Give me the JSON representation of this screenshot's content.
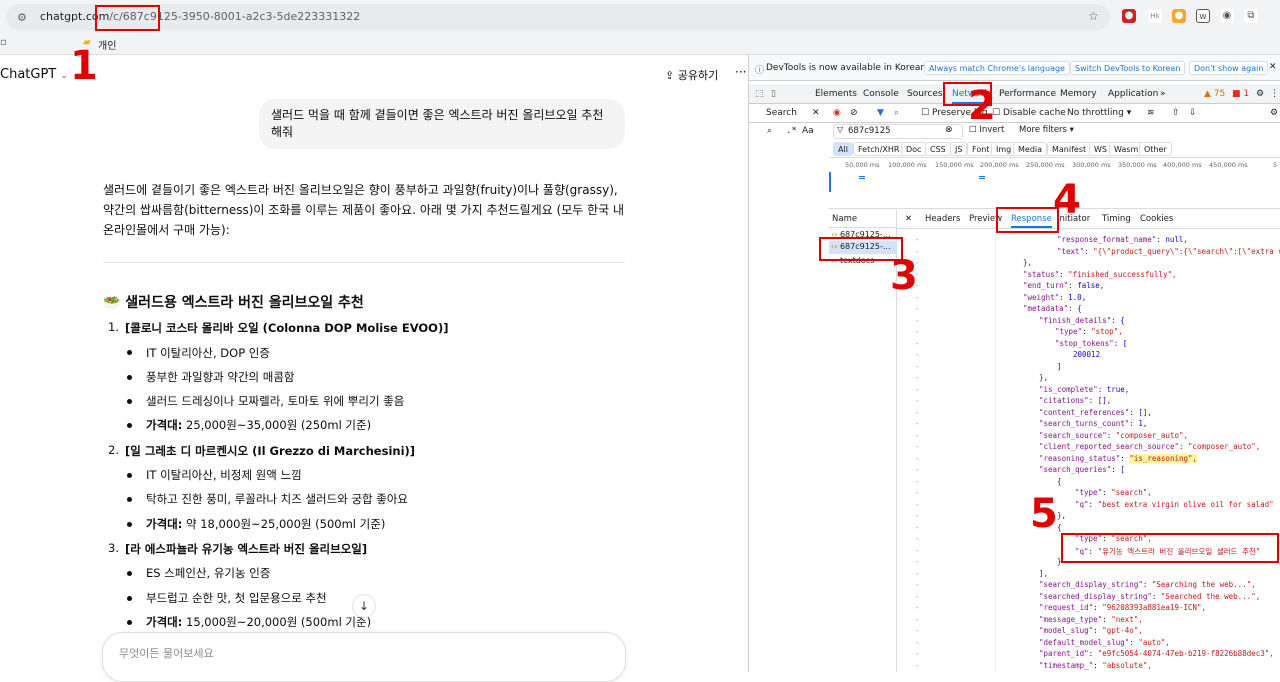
{
  "browser": {
    "url_host": "chatgpt.com",
    "url_path": "/c/687c9125-3950-8001-a2c3-5de223331322",
    "bookmark_label": "개인"
  },
  "chat": {
    "app_title": "ChatGPT",
    "share_label": "공유하기",
    "more_label": "···",
    "user_message": "샐러드 먹을 때 함께 곁들이면 좋은 엑스트라 버진 올리브오일 추천해줘",
    "intro": "샐러드에 곁들이기 좋은 엑스트라 버진 올리브오일은 향이 풍부하고 과일향(fruity)이나 풀향(grassy), 약간의 쌉싸름함(bitterness)이 조화를 이루는 제품이 좋아요. 아래 몇 가지 추천드릴게요 (모두 한국 내 온라인몰에서 구매 가능):",
    "section_title": "🥗 샐러드용 엑스트라 버진 올리브오일 추천",
    "items": [
      {
        "num": "1.",
        "title": "[콜로니 코스타 몰리바 오일 (Colonna DOP Molise EVOO)]",
        "bullets": [
          "IT 이탈리아산, DOP 인증",
          "풍부한 과일향과 약간의 매콤함",
          "샐러드 드레싱이나 모짜렐라, 토마토 위에 뿌리기 좋음"
        ],
        "price_label": "가격대:",
        "price": "25,000원~35,000원 (250ml 기준)"
      },
      {
        "num": "2.",
        "title": "[일 그레초 디 마르켄시오 (Il Grezzo di Marchesini)]",
        "bullets": [
          "IT 이탈리아산, 비정제 원액 느낌",
          "탁하고 진한 풍미, 루꼴라나 치즈 샐러드와 궁합 좋아요"
        ],
        "price_label": "가격대:",
        "price": "약 18,000원~25,000원 (500ml 기준)"
      },
      {
        "num": "3.",
        "title": "[라 에스파뇰라 유기농 엑스트라 버진 올리브오일]",
        "bullets": [
          "ES 스페인산, 유기농 인증",
          "부드럽고 순한 맛, 첫 입문용으로 추천"
        ],
        "price_label": "가격대:",
        "price": "15,000원~20,000원 (500ml 기준)"
      }
    ],
    "composer_placeholder": "무엇이든 물어보세요"
  },
  "devtools": {
    "notice": "DevTools is now available in Korean!",
    "btn_match": "Always match Chrome's language",
    "btn_switch": "Switch DevTools to Korean",
    "btn_dont": "Don't show again",
    "panels": [
      "Elements",
      "Console",
      "Sources",
      "Network",
      "Performance",
      "Memory",
      "Application",
      "»"
    ],
    "warn_count": "75",
    "err_count": "1",
    "search_label": "Search",
    "preserve_log": "Preserve log",
    "disable_cache": "Disable cache",
    "throttling": "No throttling",
    "filter_value": "687c9125",
    "invert_label": "Invert",
    "more_filters": "More filters",
    "filters": [
      "All",
      "Fetch/XHR",
      "Doc",
      "CSS",
      "JS",
      "Font",
      "Img",
      "Media",
      "Manifest",
      "WS",
      "Wasm",
      "Other"
    ],
    "timeline_ticks": [
      "50,000 ms",
      "100,000 ms",
      "150,000 ms",
      "200,000 ms",
      "250,000 ms",
      "300,000 ms",
      "350,000 ms",
      "400,000 ms",
      "450,000 ms",
      "5"
    ],
    "name_header": "Name",
    "detail_tabs": [
      "Headers",
      "Preview",
      "Response",
      "Initiator",
      "Timing",
      "Cookies"
    ],
    "requests": [
      "687c9125-...",
      "687c9125-...",
      "textdocs"
    ],
    "search_aa": "Aa",
    "json_lines": [
      "\"response_format_name\": null,",
      "\"text\": \"{\\\"product_query\\\":{\\\"search\\\":[\\\"extra virgin ol",
      "},",
      "\"status\": \"finished_successfully\",",
      "\"end_turn\": false,",
      "\"weight\": 1.0,",
      "\"metadata\": {",
      "\"finish_details\": {",
      "\"type\": \"stop\",",
      "\"stop_tokens\": [",
      "200012",
      "]",
      "},",
      "\"is_complete\": true,",
      "\"citations\": [],",
      "\"content_references\": [],",
      "\"search_turns_count\": 1,",
      "\"search_source\": \"composer_auto\",",
      "\"client_reported_search_source\": \"composer_auto\",",
      "\"reasoning_status\": \"is_reasoning\",",
      "\"search_queries\": [",
      "{",
      "\"type\": \"search\",",
      "\"q\": \"best extra virgin olive oil for salad\"",
      "},",
      "{",
      "\"type\": \"search\",",
      "\"q\": \"유기농 엑스트라 버진 올리브오일 샐러드 추천\"",
      "}",
      "],",
      "\"search_display_string\": \"Searching the web...\",",
      "\"searched_display_string\": \"Searched the web...\",",
      "\"request_id\": \"96208393a881ea19-ICN\",",
      "\"message_type\": \"next\",",
      "\"model_slug\": \"gpt-4o\",",
      "\"default_model_slug\": \"auto\",",
      "\"parent_id\": \"e9fc5054-4074-47eb-b219-f8226b88dec3\",",
      "\"timestamp_\": \"absolute\","
    ]
  },
  "annotations": [
    "1",
    "2",
    "3",
    "4",
    "5"
  ]
}
